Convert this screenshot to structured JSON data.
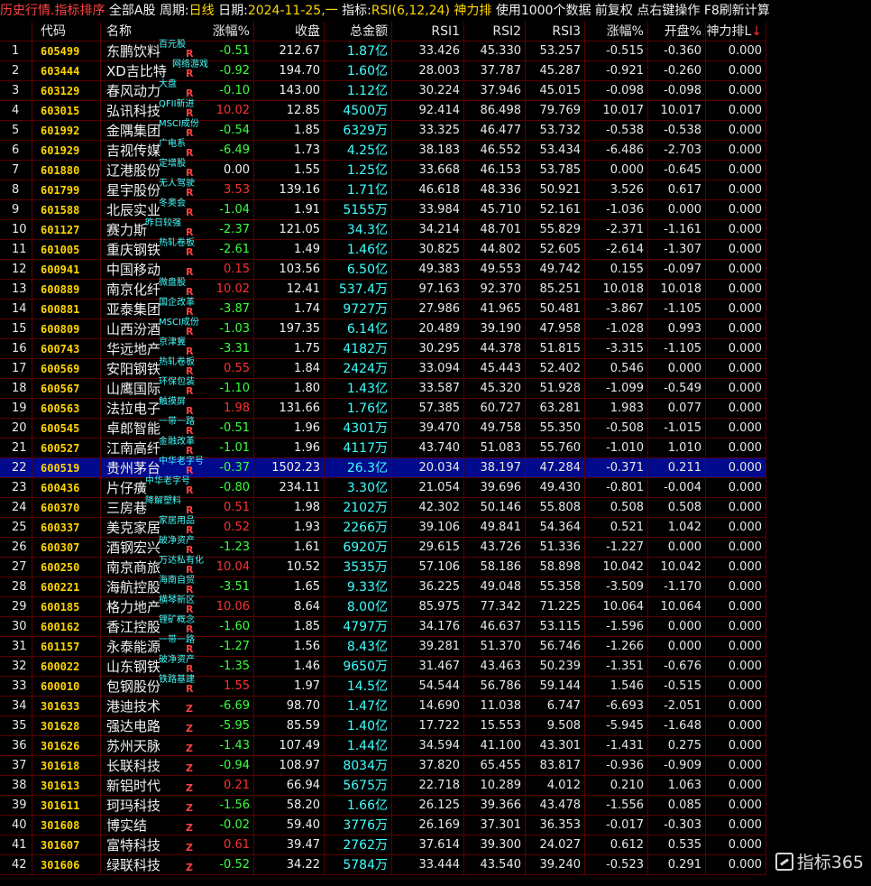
{
  "titlebar": {
    "app_title": "历史行情.指标排序",
    "market": "全部A股",
    "period_label": "周期:",
    "period_value": "日线",
    "date_label": "日期:",
    "date_value": "2024-11-25,一",
    "indicator_label": "指标:",
    "indicator_value": "RSI(6,12,24)",
    "sort_by": "神力排",
    "use_label": "使用",
    "count": "1000个数据",
    "adjust": "前复权",
    "hint": "点右键操作",
    "refresh": "F8刷新计算"
  },
  "columns": {
    "code": "代码",
    "name": "名称",
    "change": "涨幅%",
    "close": "收盘",
    "amount": "总金额",
    "rsi1": "RSI1",
    "rsi2": "RSI2",
    "rsi3": "RSI3",
    "change2": "涨幅%",
    "open": "开盘%",
    "shenli": "神力排L",
    "sort_arrow": "↓"
  },
  "rows": [
    {
      "idx": "1",
      "code": "605499",
      "name": "东鹏饮料",
      "tag": "百元股",
      "flag": "R",
      "chg": "-0.51",
      "close": "212.67",
      "amt": "1.87亿",
      "r1": "33.426",
      "r2": "45.330",
      "r3": "53.257",
      "chg2": "-0.515",
      "open": "-0.360",
      "sl": "0.000"
    },
    {
      "idx": "2",
      "code": "603444",
      "name": "XD吉比特",
      "tag": "网络游戏",
      "flag": "R",
      "chg": "-0.92",
      "close": "194.70",
      "amt": "1.60亿",
      "r1": "28.003",
      "r2": "37.787",
      "r3": "45.287",
      "chg2": "-0.921",
      "open": "-0.260",
      "sl": "0.000"
    },
    {
      "idx": "3",
      "code": "603129",
      "name": "春风动力",
      "tag": "大盘",
      "flag": "R",
      "chg": "-0.10",
      "close": "143.00",
      "amt": "1.12亿",
      "r1": "30.224",
      "r2": "37.946",
      "r3": "45.015",
      "chg2": "-0.098",
      "open": "-0.098",
      "sl": "0.000"
    },
    {
      "idx": "4",
      "code": "603015",
      "name": "弘讯科技",
      "tag": "QFII新进",
      "flag": "R",
      "chg": "10.02",
      "close": "12.85",
      "amt": "4500万",
      "r1": "92.414",
      "r2": "86.498",
      "r3": "79.769",
      "chg2": "10.017",
      "open": "10.017",
      "sl": "0.000"
    },
    {
      "idx": "5",
      "code": "601992",
      "name": "金隅集团",
      "tag": "MSCI成份",
      "flag": "R",
      "chg": "-0.54",
      "close": "1.85",
      "amt": "6329万",
      "r1": "33.325",
      "r2": "46.477",
      "r3": "53.732",
      "chg2": "-0.538",
      "open": "-0.538",
      "sl": "0.000"
    },
    {
      "idx": "6",
      "code": "601929",
      "name": "吉视传媒",
      "tag": "广电系",
      "flag": "R",
      "chg": "-6.49",
      "close": "1.73",
      "amt": "4.25亿",
      "r1": "38.183",
      "r2": "46.552",
      "r3": "53.434",
      "chg2": "-6.486",
      "open": "-2.703",
      "sl": "0.000"
    },
    {
      "idx": "7",
      "code": "601880",
      "name": "辽港股份",
      "tag": "定增股",
      "flag": "R",
      "chg": "0.00",
      "close": "1.55",
      "amt": "1.25亿",
      "r1": "33.668",
      "r2": "46.153",
      "r3": "53.785",
      "chg2": "0.000",
      "open": "-0.645",
      "sl": "0.000"
    },
    {
      "idx": "8",
      "code": "601799",
      "name": "星宇股份",
      "tag": "无人驾驶",
      "flag": "R",
      "chg": "3.53",
      "close": "139.16",
      "amt": "1.71亿",
      "r1": "46.618",
      "r2": "48.336",
      "r3": "50.921",
      "chg2": "3.526",
      "open": "0.617",
      "sl": "0.000"
    },
    {
      "idx": "9",
      "code": "601588",
      "name": "北辰实业",
      "tag": "冬奥会",
      "flag": "R",
      "chg": "-1.04",
      "close": "1.91",
      "amt": "5155万",
      "r1": "33.984",
      "r2": "45.710",
      "r3": "52.161",
      "chg2": "-1.036",
      "open": "0.000",
      "sl": "0.000"
    },
    {
      "idx": "10",
      "code": "601127",
      "name": "赛力斯",
      "tag": "昨日较强",
      "flag": "R",
      "chg": "-2.37",
      "close": "121.05",
      "amt": "34.3亿",
      "r1": "34.214",
      "r2": "48.701",
      "r3": "55.829",
      "chg2": "-2.371",
      "open": "-1.161",
      "sl": "0.000"
    },
    {
      "idx": "11",
      "code": "601005",
      "name": "重庆钢铁",
      "tag": "热轧卷板",
      "flag": "R",
      "chg": "-2.61",
      "close": "1.49",
      "amt": "1.46亿",
      "r1": "30.825",
      "r2": "44.802",
      "r3": "52.605",
      "chg2": "-2.614",
      "open": "-1.307",
      "sl": "0.000"
    },
    {
      "idx": "12",
      "code": "600941",
      "name": "中国移动",
      "tag": "",
      "flag": "R",
      "chg": "0.15",
      "close": "103.56",
      "amt": "6.50亿",
      "r1": "49.383",
      "r2": "49.553",
      "r3": "49.742",
      "chg2": "0.155",
      "open": "-0.097",
      "sl": "0.000"
    },
    {
      "idx": "13",
      "code": "600889",
      "name": "南京化纤",
      "tag": "微盘股",
      "flag": "R",
      "chg": "10.02",
      "close": "12.41",
      "amt": "537.4万",
      "r1": "97.163",
      "r2": "92.370",
      "r3": "85.251",
      "chg2": "10.018",
      "open": "10.018",
      "sl": "0.000"
    },
    {
      "idx": "14",
      "code": "600881",
      "name": "亚泰集团",
      "tag": "国企改革",
      "flag": "R",
      "chg": "-3.87",
      "close": "1.74",
      "amt": "9727万",
      "r1": "27.986",
      "r2": "41.965",
      "r3": "50.481",
      "chg2": "-3.867",
      "open": "-1.105",
      "sl": "0.000"
    },
    {
      "idx": "15",
      "code": "600809",
      "name": "山西汾酒",
      "tag": "MSCI成份",
      "flag": "R",
      "chg": "-1.03",
      "close": "197.35",
      "amt": "6.14亿",
      "r1": "20.489",
      "r2": "39.190",
      "r3": "47.958",
      "chg2": "-1.028",
      "open": "0.993",
      "sl": "0.000"
    },
    {
      "idx": "16",
      "code": "600743",
      "name": "华远地产",
      "tag": "京津冀",
      "flag": "R",
      "chg": "-3.31",
      "close": "1.75",
      "amt": "4182万",
      "r1": "30.295",
      "r2": "44.378",
      "r3": "51.815",
      "chg2": "-3.315",
      "open": "-1.105",
      "sl": "0.000"
    },
    {
      "idx": "17",
      "code": "600569",
      "name": "安阳钢铁",
      "tag": "热轧卷板",
      "flag": "R",
      "chg": "0.55",
      "close": "1.84",
      "amt": "2424万",
      "r1": "33.094",
      "r2": "45.443",
      "r3": "52.402",
      "chg2": "0.546",
      "open": "0.000",
      "sl": "0.000"
    },
    {
      "idx": "18",
      "code": "600567",
      "name": "山鹰国际",
      "tag": "环保包装",
      "flag": "R",
      "chg": "-1.10",
      "close": "1.80",
      "amt": "1.43亿",
      "r1": "33.587",
      "r2": "45.320",
      "r3": "51.928",
      "chg2": "-1.099",
      "open": "-0.549",
      "sl": "0.000"
    },
    {
      "idx": "19",
      "code": "600563",
      "name": "法拉电子",
      "tag": "触摸屏",
      "flag": "R",
      "chg": "1.98",
      "close": "131.66",
      "amt": "1.76亿",
      "r1": "57.385",
      "r2": "60.727",
      "r3": "63.281",
      "chg2": "1.983",
      "open": "0.077",
      "sl": "0.000"
    },
    {
      "idx": "20",
      "code": "600545",
      "name": "卓郎智能",
      "tag": "一带一路",
      "flag": "R",
      "chg": "-0.51",
      "close": "1.96",
      "amt": "4301万",
      "r1": "39.470",
      "r2": "49.758",
      "r3": "55.350",
      "chg2": "-0.508",
      "open": "-1.015",
      "sl": "0.000"
    },
    {
      "idx": "21",
      "code": "600527",
      "name": "江南高纤",
      "tag": "金融改革",
      "flag": "R",
      "chg": "-1.01",
      "close": "1.96",
      "amt": "4117万",
      "r1": "43.740",
      "r2": "51.083",
      "r3": "55.760",
      "chg2": "-1.010",
      "open": "1.010",
      "sl": "0.000"
    },
    {
      "idx": "22",
      "code": "600519",
      "name": "贵州茅台",
      "tag": "中华老字号",
      "flag": "R",
      "chg": "-0.37",
      "close": "1502.23",
      "amt": "26.3亿",
      "r1": "20.034",
      "r2": "38.197",
      "r3": "47.284",
      "chg2": "-0.371",
      "open": "0.211",
      "sl": "0.000",
      "selected": true
    },
    {
      "idx": "23",
      "code": "600436",
      "name": "片仔癀",
      "tag": "中华老字号",
      "flag": "R",
      "chg": "-0.80",
      "close": "234.11",
      "amt": "3.30亿",
      "r1": "21.054",
      "r2": "39.696",
      "r3": "49.430",
      "chg2": "-0.801",
      "open": "-0.004",
      "sl": "0.000"
    },
    {
      "idx": "24",
      "code": "600370",
      "name": "三房巷",
      "tag": "降解塑料",
      "flag": "R",
      "chg": "0.51",
      "close": "1.98",
      "amt": "2102万",
      "r1": "42.302",
      "r2": "50.146",
      "r3": "55.808",
      "chg2": "0.508",
      "open": "0.508",
      "sl": "0.000"
    },
    {
      "idx": "25",
      "code": "600337",
      "name": "美克家居",
      "tag": "家居用品",
      "flag": "R",
      "chg": "0.52",
      "close": "1.93",
      "amt": "2266万",
      "r1": "39.106",
      "r2": "49.841",
      "r3": "54.364",
      "chg2": "0.521",
      "open": "1.042",
      "sl": "0.000"
    },
    {
      "idx": "26",
      "code": "600307",
      "name": "酒钢宏兴",
      "tag": "破净资产",
      "flag": "R",
      "chg": "-1.23",
      "close": "1.61",
      "amt": "6920万",
      "r1": "29.615",
      "r2": "43.726",
      "r3": "51.336",
      "chg2": "-1.227",
      "open": "0.000",
      "sl": "0.000"
    },
    {
      "idx": "27",
      "code": "600250",
      "name": "南京商旅",
      "tag": "万达私有化",
      "flag": "R",
      "chg": "10.04",
      "close": "10.52",
      "amt": "3535万",
      "r1": "57.106",
      "r2": "58.186",
      "r3": "58.898",
      "chg2": "10.042",
      "open": "10.042",
      "sl": "0.000"
    },
    {
      "idx": "28",
      "code": "600221",
      "name": "海航控股",
      "tag": "海南自贸",
      "flag": "R",
      "chg": "-3.51",
      "close": "1.65",
      "amt": "9.33亿",
      "r1": "36.225",
      "r2": "49.048",
      "r3": "55.358",
      "chg2": "-3.509",
      "open": "-1.170",
      "sl": "0.000"
    },
    {
      "idx": "29",
      "code": "600185",
      "name": "格力地产",
      "tag": "横琴新区",
      "flag": "R",
      "chg": "10.06",
      "close": "8.64",
      "amt": "8.00亿",
      "r1": "85.975",
      "r2": "77.342",
      "r3": "71.225",
      "chg2": "10.064",
      "open": "10.064",
      "sl": "0.000"
    },
    {
      "idx": "30",
      "code": "600162",
      "name": "香江控股",
      "tag": "锂矿概念",
      "flag": "R",
      "chg": "-1.60",
      "close": "1.85",
      "amt": "4797万",
      "r1": "34.176",
      "r2": "46.637",
      "r3": "53.115",
      "chg2": "-1.596",
      "open": "0.000",
      "sl": "0.000"
    },
    {
      "idx": "31",
      "code": "601157",
      "name": "永泰能源",
      "tag": "一带一路",
      "flag": "R",
      "chg": "-1.27",
      "close": "1.56",
      "amt": "8.43亿",
      "r1": "39.281",
      "r2": "51.370",
      "r3": "56.746",
      "chg2": "-1.266",
      "open": "0.000",
      "sl": "0.000"
    },
    {
      "idx": "32",
      "code": "600022",
      "name": "山东钢铁",
      "tag": "破净资产",
      "flag": "R",
      "chg": "-1.35",
      "close": "1.46",
      "amt": "9650万",
      "r1": "31.467",
      "r2": "43.463",
      "r3": "50.239",
      "chg2": "-1.351",
      "open": "-0.676",
      "sl": "0.000"
    },
    {
      "idx": "33",
      "code": "600010",
      "name": "包钢股份",
      "tag": "铁路基建",
      "flag": "R",
      "chg": "1.55",
      "close": "1.97",
      "amt": "14.5亿",
      "r1": "54.544",
      "r2": "56.786",
      "r3": "59.144",
      "chg2": "1.546",
      "open": "-0.515",
      "sl": "0.000"
    },
    {
      "idx": "34",
      "code": "301633",
      "name": "港迪技术",
      "tag": "",
      "flag": "Z",
      "chg": "-6.69",
      "close": "98.70",
      "amt": "1.47亿",
      "r1": "14.690",
      "r2": "11.038",
      "r3": "6.747",
      "chg2": "-6.693",
      "open": "-2.051",
      "sl": "0.000"
    },
    {
      "idx": "35",
      "code": "301628",
      "name": "强达电路",
      "tag": "",
      "flag": "Z",
      "chg": "-5.95",
      "close": "85.59",
      "amt": "1.40亿",
      "r1": "17.722",
      "r2": "15.553",
      "r3": "9.508",
      "chg2": "-5.945",
      "open": "-1.648",
      "sl": "0.000"
    },
    {
      "idx": "36",
      "code": "301626",
      "name": "苏州天脉",
      "tag": "",
      "flag": "Z",
      "chg": "-1.43",
      "close": "107.49",
      "amt": "1.44亿",
      "r1": "34.594",
      "r2": "41.100",
      "r3": "43.301",
      "chg2": "-1.431",
      "open": "0.275",
      "sl": "0.000"
    },
    {
      "idx": "37",
      "code": "301618",
      "name": "长联科技",
      "tag": "",
      "flag": "Z",
      "chg": "-0.94",
      "close": "108.97",
      "amt": "8034万",
      "r1": "37.820",
      "r2": "65.455",
      "r3": "83.817",
      "chg2": "-0.936",
      "open": "-0.909",
      "sl": "0.000"
    },
    {
      "idx": "38",
      "code": "301613",
      "name": "新铝时代",
      "tag": "",
      "flag": "Z",
      "chg": "0.21",
      "close": "66.94",
      "amt": "5675万",
      "r1": "22.718",
      "r2": "10.289",
      "r3": "4.012",
      "chg2": "0.210",
      "open": "1.063",
      "sl": "0.000"
    },
    {
      "idx": "39",
      "code": "301611",
      "name": "珂玛科技",
      "tag": "",
      "flag": "Z",
      "chg": "-1.56",
      "close": "58.20",
      "amt": "1.66亿",
      "r1": "26.125",
      "r2": "39.366",
      "r3": "43.478",
      "chg2": "-1.556",
      "open": "0.085",
      "sl": "0.000"
    },
    {
      "idx": "40",
      "code": "301608",
      "name": "博实结",
      "tag": "",
      "flag": "Z",
      "chg": "-0.02",
      "close": "59.40",
      "amt": "3776万",
      "r1": "26.169",
      "r2": "37.301",
      "r3": "36.353",
      "chg2": "-0.017",
      "open": "-0.303",
      "sl": "0.000"
    },
    {
      "idx": "41",
      "code": "301607",
      "name": "富特科技",
      "tag": "",
      "flag": "Z",
      "chg": "0.61",
      "close": "39.47",
      "amt": "2762万",
      "r1": "37.614",
      "r2": "39.300",
      "r3": "24.027",
      "chg2": "0.612",
      "open": "0.535",
      "sl": "0.000"
    },
    {
      "idx": "42",
      "code": "301606",
      "name": "绿联科技",
      "tag": "",
      "flag": "Z",
      "chg": "-0.52",
      "close": "34.22",
      "amt": "5784万",
      "r1": "33.444",
      "r2": "43.540",
      "r3": "39.240",
      "chg2": "-0.523",
      "open": "0.291",
      "sl": "0.000"
    }
  ],
  "brand": {
    "text": "指标365"
  },
  "colors": {
    "up": "#ff3030",
    "down": "#3cff3c",
    "code": "#ffd500",
    "amount": "#40ffff",
    "selected_row": "#000a8c",
    "grid": "#5a0000"
  }
}
